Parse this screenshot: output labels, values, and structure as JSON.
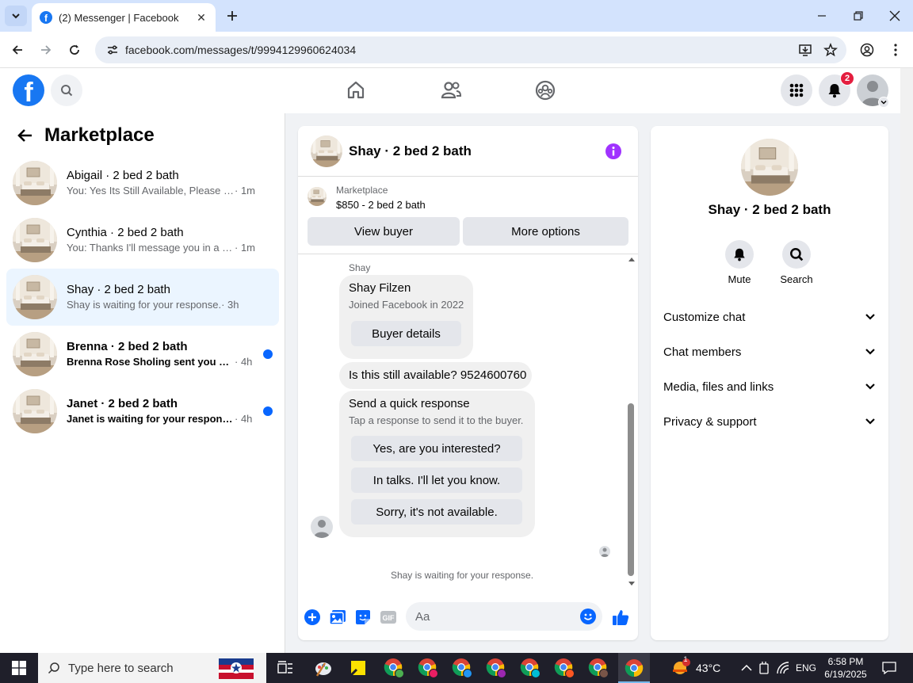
{
  "browser": {
    "tab_title": "(2) Messenger | Facebook",
    "url": "facebook.com/messages/t/9994129960624034"
  },
  "fb_header": {
    "notification_count": "2"
  },
  "left_panel": {
    "title": "Marketplace",
    "conversations": [
      {
        "name": "Abigail · 2 bed 2 bath",
        "snippet": "You: Yes Its Still Available, Please Sen...",
        "time": " · 1m",
        "unread": false,
        "active": false
      },
      {
        "name": "Cynthia · 2 bed 2 bath",
        "snippet": "You: Thanks I'll message you in a mo...",
        "time": " · 1m",
        "unread": false,
        "active": false
      },
      {
        "name": "Shay · 2 bed 2 bath",
        "snippet": "Shay is waiting for your response.",
        "time": " · 3h",
        "unread": false,
        "active": true
      },
      {
        "name": "Brenna · 2 bed 2 bath",
        "snippet": "Brenna Rose Sholing sent you a m...",
        "time": " · 4h",
        "unread": true,
        "active": false
      },
      {
        "name": "Janet · 2 bed 2 bath",
        "snippet": "Janet is waiting for your response.",
        "time": " · 4h",
        "unread": true,
        "active": false
      }
    ]
  },
  "chat": {
    "title": "Shay · 2 bed 2 bath",
    "listing_label": "Marketplace",
    "listing_price": "$850 - 2 bed 2 bath",
    "view_buyer": "View buyer",
    "more_options": "More options",
    "sender": "Shay",
    "profile_name": "Shay Filzen",
    "profile_joined": "Joined Facebook in 2022",
    "buyer_details": "Buyer details",
    "message": "Is this still available? 9524600760",
    "quick_title": "Send a quick response",
    "quick_sub": "Tap a response to send it to the buyer.",
    "quick_replies": [
      "Yes, are you interested?",
      "In talks. I'll let you know.",
      "Sorry, it's not available."
    ],
    "waiting": "Shay is waiting for your response.",
    "input_placeholder": "Aa"
  },
  "right_panel": {
    "name": "Shay · 2 bed 2 bath",
    "mute": "Mute",
    "search": "Search",
    "sections": [
      "Customize chat",
      "Chat members",
      "Media, files and links",
      "Privacy & support"
    ]
  },
  "taskbar": {
    "search_placeholder": "Type here to search",
    "weather_badge": "1",
    "temperature": "43°C",
    "language": "ENG",
    "time": "6:58 PM",
    "date": "6/19/2025"
  },
  "colors": {
    "fb_blue": "#1877f2",
    "messenger_blue": "#0866ff",
    "info_purple": "#a033ff",
    "active_row": "#ebf5ff",
    "badge_red": "#e41e3f"
  }
}
